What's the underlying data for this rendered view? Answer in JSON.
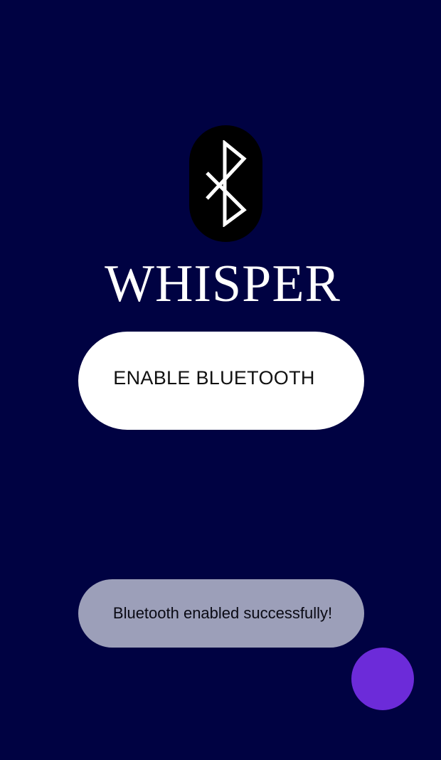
{
  "app": {
    "title": "WHISPER"
  },
  "logo": {
    "icon": "bluetooth-icon"
  },
  "enable_button": {
    "label": "ENABLE BLUETOOTH"
  },
  "toast": {
    "message": "Bluetooth enabled successfully!"
  },
  "fab": {
    "icon": "none"
  },
  "colors": {
    "background": "#000242",
    "logo_pill": "#000000",
    "button_bg": "#ffffff",
    "toast_bg": "#9c9fb9",
    "fab": "#6c2bd9"
  }
}
